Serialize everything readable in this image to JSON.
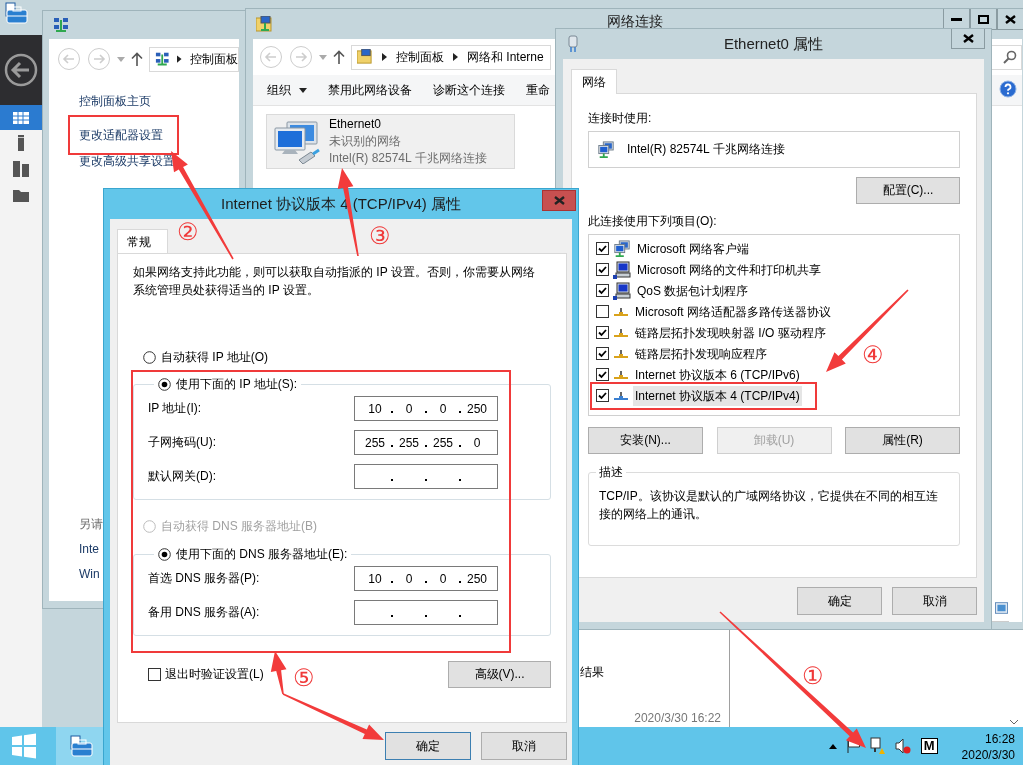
{
  "server_manager": {
    "result_label": "结果",
    "timestamp": "2020/3/30 16:22"
  },
  "control_panel": {
    "breadcrumb": [
      "控制面板"
    ],
    "links": [
      {
        "label": "控制面板主页",
        "highlighted": false
      },
      {
        "label": "更改适配器设置",
        "highlighted": true
      },
      {
        "label": "更改高级共享设置",
        "highlighted": false
      }
    ],
    "see_also": {
      "heading": "另请",
      "links": [
        "Inte",
        "Win"
      ]
    }
  },
  "network_connections": {
    "title": "网络连接",
    "breadcrumb": [
      "控制面板",
      "网络和 Interne"
    ],
    "toolbar": [
      {
        "label": "组织",
        "dropdown": true
      },
      {
        "label": "禁用此网络设备",
        "dropdown": false
      },
      {
        "label": "诊断这个连接",
        "dropdown": false
      },
      {
        "label": "重命",
        "dropdown": false
      }
    ],
    "adapter": {
      "name": "Ethernet0",
      "status": "未识别的网络",
      "device": "Intel(R) 82574L 千兆网络连接"
    }
  },
  "ethernet_properties": {
    "title": "Ethernet0 属性",
    "tabs": [
      {
        "label": "网络",
        "selected": true
      }
    ],
    "connect_using_label": "连接时使用:",
    "device": "Intel(R) 82574L 千兆网络连接",
    "configure_button": "配置(C)...",
    "items_label": "此连接使用下列项目(O):",
    "items": [
      {
        "kind": "client",
        "label": "Microsoft 网络客户端",
        "checked": true,
        "selected": false,
        "highlighted": false
      },
      {
        "kind": "service",
        "label": "Microsoft 网络的文件和打印机共享",
        "checked": true,
        "selected": false,
        "highlighted": false
      },
      {
        "kind": "service",
        "label": "QoS 数据包计划程序",
        "checked": true,
        "selected": false,
        "highlighted": false
      },
      {
        "kind": "protocol",
        "label": "Microsoft 网络适配器多路传送器协议",
        "checked": false,
        "selected": false,
        "highlighted": false
      },
      {
        "kind": "protocol",
        "label": "链路层拓扑发现映射器 I/O 驱动程序",
        "checked": true,
        "selected": false,
        "highlighted": false
      },
      {
        "kind": "protocol",
        "label": "链路层拓扑发现响应程序",
        "checked": true,
        "selected": false,
        "highlighted": false
      },
      {
        "kind": "protocol",
        "label": "Internet 协议版本 6 (TCP/IPv6)",
        "checked": true,
        "selected": false,
        "highlighted": false
      },
      {
        "kind": "protocol",
        "label": "Internet 协议版本 4 (TCP/IPv4)",
        "checked": true,
        "selected": true,
        "highlighted": true
      }
    ],
    "item_buttons": [
      {
        "label": "安装(N)...",
        "disabled": false
      },
      {
        "label": "卸载(U)",
        "disabled": true
      },
      {
        "label": "属性(R)",
        "disabled": false
      }
    ],
    "description": {
      "heading": "描述",
      "text": "TCP/IP。该协议是默认的广域网络协议，它提供在不同的相互连接的网络上的通讯。"
    },
    "buttons": [
      "确定",
      "取消"
    ]
  },
  "ipv4_properties": {
    "title": "Internet 协议版本 4 (TCP/IPv4) 属性",
    "tabs": [
      {
        "label": "常规",
        "selected": true
      }
    ],
    "intro": "如果网络支持此功能，则可以获取自动指派的 IP 设置。否则，你需要从网络系统管理员处获得适当的 IP 设置。",
    "ip_mode": [
      {
        "label": "自动获得 IP 地址(O)",
        "selected": false,
        "disabled": false
      },
      {
        "label": "使用下面的 IP 地址(S):",
        "selected": true,
        "disabled": false
      }
    ],
    "ip_fields": [
      {
        "label": "IP 地址(I):",
        "octets": [
          "10",
          "0",
          "0",
          "250"
        ]
      },
      {
        "label": "子网掩码(U):",
        "octets": [
          "255",
          "255",
          "255",
          "0"
        ]
      },
      {
        "label": "默认网关(D):"
      }
    ],
    "dns_mode": [
      {
        "label": "自动获得 DNS 服务器地址(B)",
        "selected": false,
        "disabled": true
      },
      {
        "label": "使用下面的 DNS 服务器地址(E):",
        "selected": true,
        "disabled": false
      }
    ],
    "dns_fields": [
      {
        "label": "首选 DNS 服务器(P):",
        "octets": [
          "10",
          "0",
          "0",
          "250"
        ]
      },
      {
        "label": "备用 DNS 服务器(A):"
      }
    ],
    "highlight_settings": true,
    "validate_on_exit": {
      "label": "退出时验证设置(L)",
      "checked": false
    },
    "advanced_button": "高级(V)...",
    "buttons": [
      {
        "label": "确定",
        "default": true
      },
      {
        "label": "取消",
        "default": false
      }
    ]
  },
  "taskbar": {
    "ime_indicator": "M",
    "time": "16:28",
    "date": "2020/3/30"
  },
  "annotations": [
    {
      "label": "①"
    },
    {
      "label": "②"
    },
    {
      "label": "③"
    },
    {
      "label": "④"
    },
    {
      "label": "⑤"
    }
  ]
}
